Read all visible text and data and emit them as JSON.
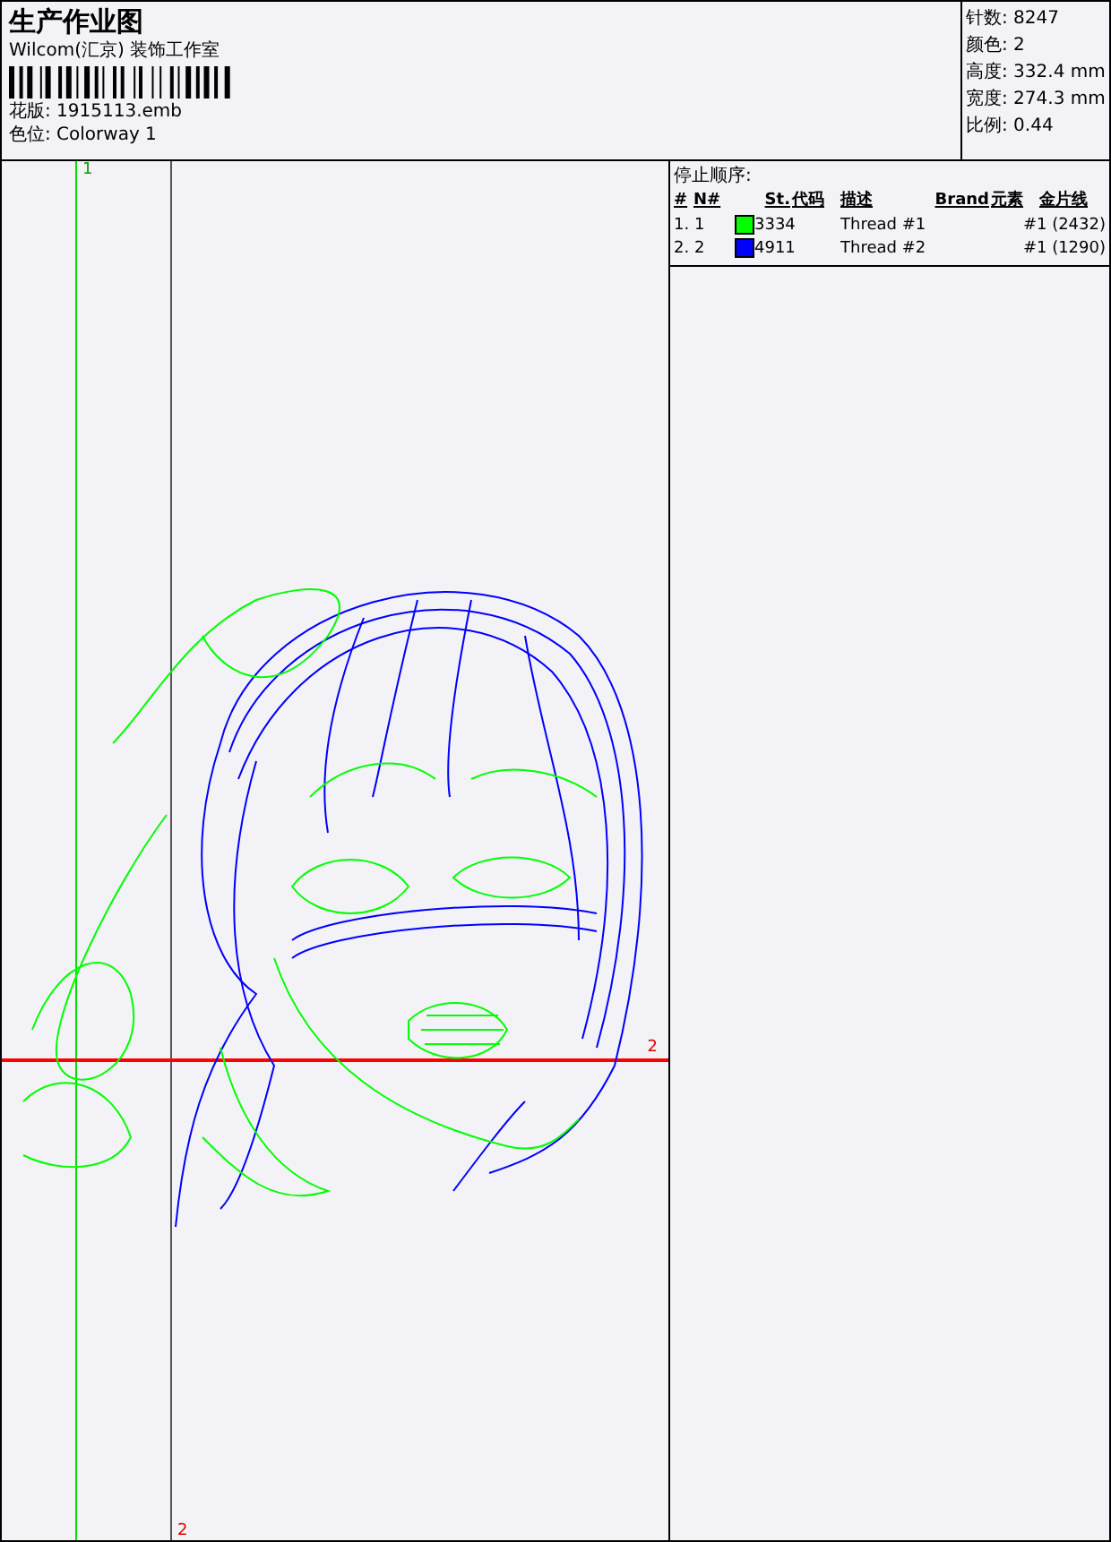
{
  "title": "生产作业图",
  "company": "Wilcom(汇京) 装饰工作室",
  "design_info": [
    {
      "label": "花版:",
      "value": "1915113.emb"
    },
    {
      "label": "色位:",
      "value": "Colorway 1"
    }
  ],
  "stats": [
    {
      "label": "针数:",
      "value": "8247"
    },
    {
      "label": "颜色:",
      "value": "2"
    },
    {
      "label": "高度:",
      "value": "332.4 mm"
    },
    {
      "label": "宽度:",
      "value": "274.3 mm"
    },
    {
      "label": "比例:",
      "value": "0.44"
    }
  ],
  "stop_sequence": {
    "title": "停止顺序:",
    "columns": [
      "#",
      "N#",
      "St.",
      "代码",
      "描述",
      "Brand",
      "元素",
      "金片线"
    ],
    "rows": [
      {
        "index": "1. 1",
        "color": "#00ff00",
        "code": "3334",
        "description": "Thread #1",
        "sequin": "#1 (2432)"
      },
      {
        "index": "2. 2",
        "color": "#0000ff",
        "code": "4911",
        "description": "Thread #2",
        "sequin": "#1 (1290)"
      }
    ]
  },
  "canvas": {
    "guide_vertical_1": "1",
    "guide_vertical_2": "2",
    "guide_horizontal": "2"
  }
}
